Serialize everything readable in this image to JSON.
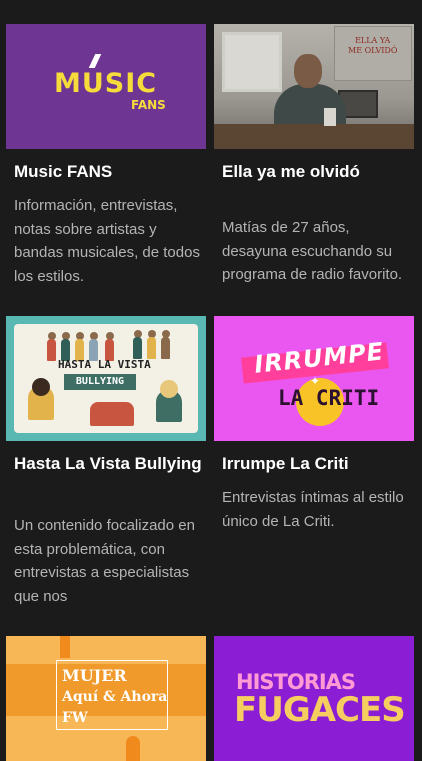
{
  "cards": [
    {
      "title": "Music FANS",
      "description": "Información, entrevistas, notas sobre artistas y bandas musicales, de todos los estilos.",
      "thumb_text": [
        "MUSIC",
        "FANS"
      ],
      "thumb_color": "#6e3593"
    },
    {
      "title": "Ella ya me olvidó",
      "description": "Matías de 27 años, desayuna escuchando su programa de radio favorito. Una chica que se",
      "thumb_text": [
        "ELLA YA",
        "ME OLVIDÓ"
      ],
      "thumb_color": "#7d7d7a"
    },
    {
      "title": "Hasta La Vista Bullying",
      "description": "Un contenido focalizado en esta problemática, con entrevistas a especialistas que nos",
      "thumb_text": [
        "HASTA LA VISTA",
        "BULLYING"
      ],
      "thumb_color": "#5ab8b2"
    },
    {
      "title": "Irrumpe La Criti",
      "description": "Entrevistas íntimas al estilo único de La Criti.",
      "thumb_text": [
        "IRRUMPE",
        "LA CRITI"
      ],
      "thumb_color": "#ea57f0"
    },
    {
      "title": "",
      "description": "",
      "thumb_text": [
        "MUJER",
        "Aquí & Ahora",
        "FW"
      ],
      "thumb_color": "#f7b756"
    },
    {
      "title": "",
      "description": "",
      "thumb_text": [
        "HISTORIAS",
        "FUGACES"
      ],
      "thumb_color": "#8b1ed4"
    }
  ]
}
